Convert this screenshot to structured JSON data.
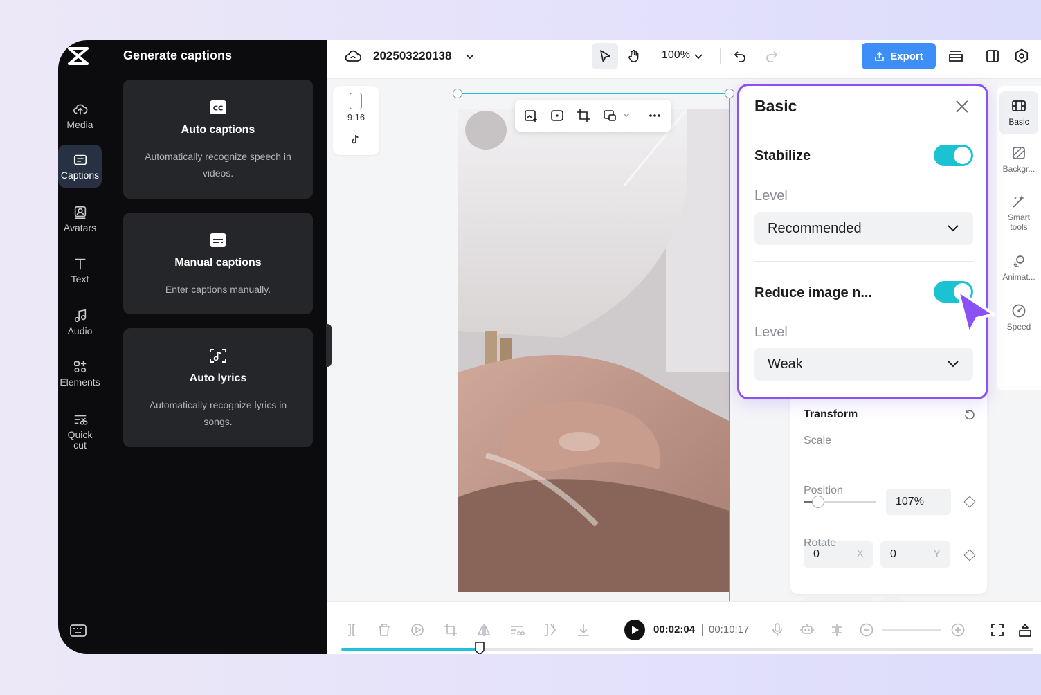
{
  "sidebar": {
    "items": [
      {
        "label": "Media",
        "icon": "cloud-upload-icon"
      },
      {
        "label": "Captions",
        "icon": "captions-icon",
        "active": true
      },
      {
        "label": "Avatars",
        "icon": "avatar-icon"
      },
      {
        "label": "Text",
        "icon": "text-icon"
      },
      {
        "label": "Audio",
        "icon": "music-note-icon"
      },
      {
        "label": "Elements",
        "icon": "elements-icon"
      },
      {
        "label": "Quick",
        "label2": "cut",
        "icon": "quick-cut-icon"
      }
    ]
  },
  "captions_panel": {
    "title": "Generate captions",
    "cards": [
      {
        "title": "Auto captions",
        "desc": "Automatically recognize speech in videos."
      },
      {
        "title": "Manual captions",
        "desc": "Enter captions manually."
      },
      {
        "title": "Auto lyrics",
        "desc": "Automatically recognize lyrics in songs."
      }
    ]
  },
  "topbar": {
    "project_name": "202503220138",
    "zoom": "100%",
    "export_label": "Export"
  },
  "canvas": {
    "aspect_ratio": "9:16"
  },
  "right_tabs": [
    {
      "label": "Basic",
      "active": true
    },
    {
      "label": "Backgr..."
    },
    {
      "label": "Smart",
      "label2": "tools"
    },
    {
      "label": "Animat..."
    },
    {
      "label": "Speed"
    }
  ],
  "basic_panel": {
    "title": "Basic",
    "stabilize_label": "Stabilize",
    "stabilize_on": true,
    "stabilize_level_label": "Level",
    "stabilize_level_value": "Recommended",
    "reduce_noise_label": "Reduce image n...",
    "reduce_noise_on": true,
    "reduce_level_label": "Level",
    "reduce_level_value": "Weak"
  },
  "transform": {
    "title": "Transform",
    "scale_label": "Scale",
    "scale_value": "107%",
    "scale_fraction": 0.2,
    "position_label": "Position",
    "pos_x": "0",
    "pos_x_axis": "X",
    "pos_y": "0",
    "pos_y_axis": "Y",
    "rotate_label": "Rotate",
    "rotate_value": "0°"
  },
  "timeline": {
    "current_time": "00:02:04",
    "total_time": "00:10:17",
    "progress_fraction": 0.2
  },
  "colors": {
    "accent": "#22c1d9",
    "export": "#3d8ef6",
    "popup_border": "#8c51f5",
    "toggle_on": "#1bc2d2"
  }
}
